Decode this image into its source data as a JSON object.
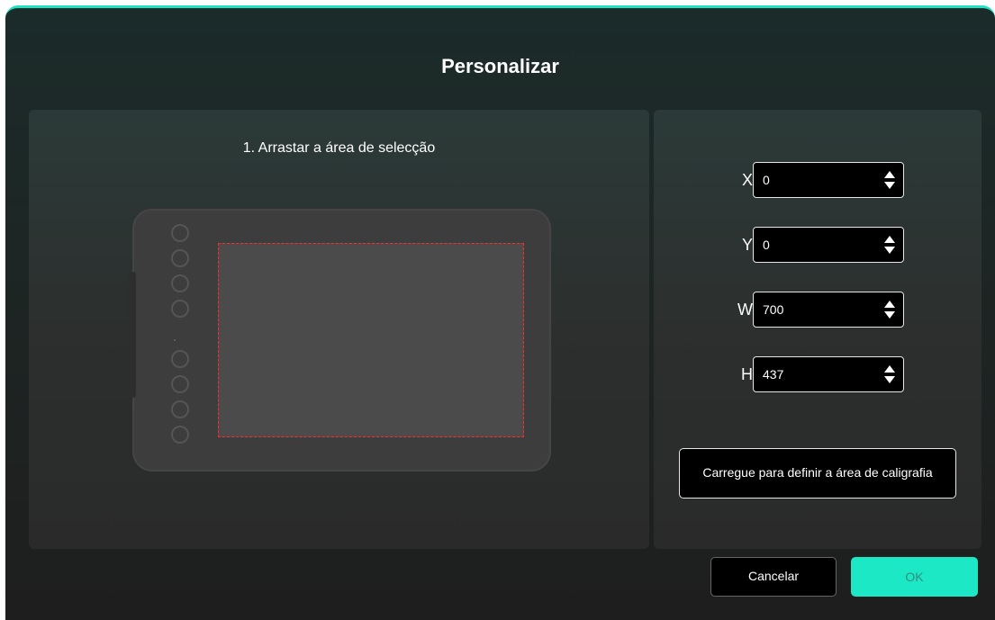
{
  "dialog": {
    "title": "Personalizar",
    "accent_color": "#1de3c3"
  },
  "selection_panel": {
    "instruction": "1. Arrastar a área de selecção",
    "tablet": {
      "express_key_count": 8,
      "selection_color": "#ff2a2a"
    }
  },
  "fields": [
    {
      "label": "X",
      "value": "0"
    },
    {
      "label": "Y",
      "value": "0"
    },
    {
      "label": "W",
      "value": "700"
    },
    {
      "label": "H",
      "value": "437"
    }
  ],
  "calibration_button": {
    "label": "Carregue para definir a área de caligrafia"
  },
  "footer": {
    "cancel_label": "Cancelar",
    "ok_label": "OK"
  }
}
